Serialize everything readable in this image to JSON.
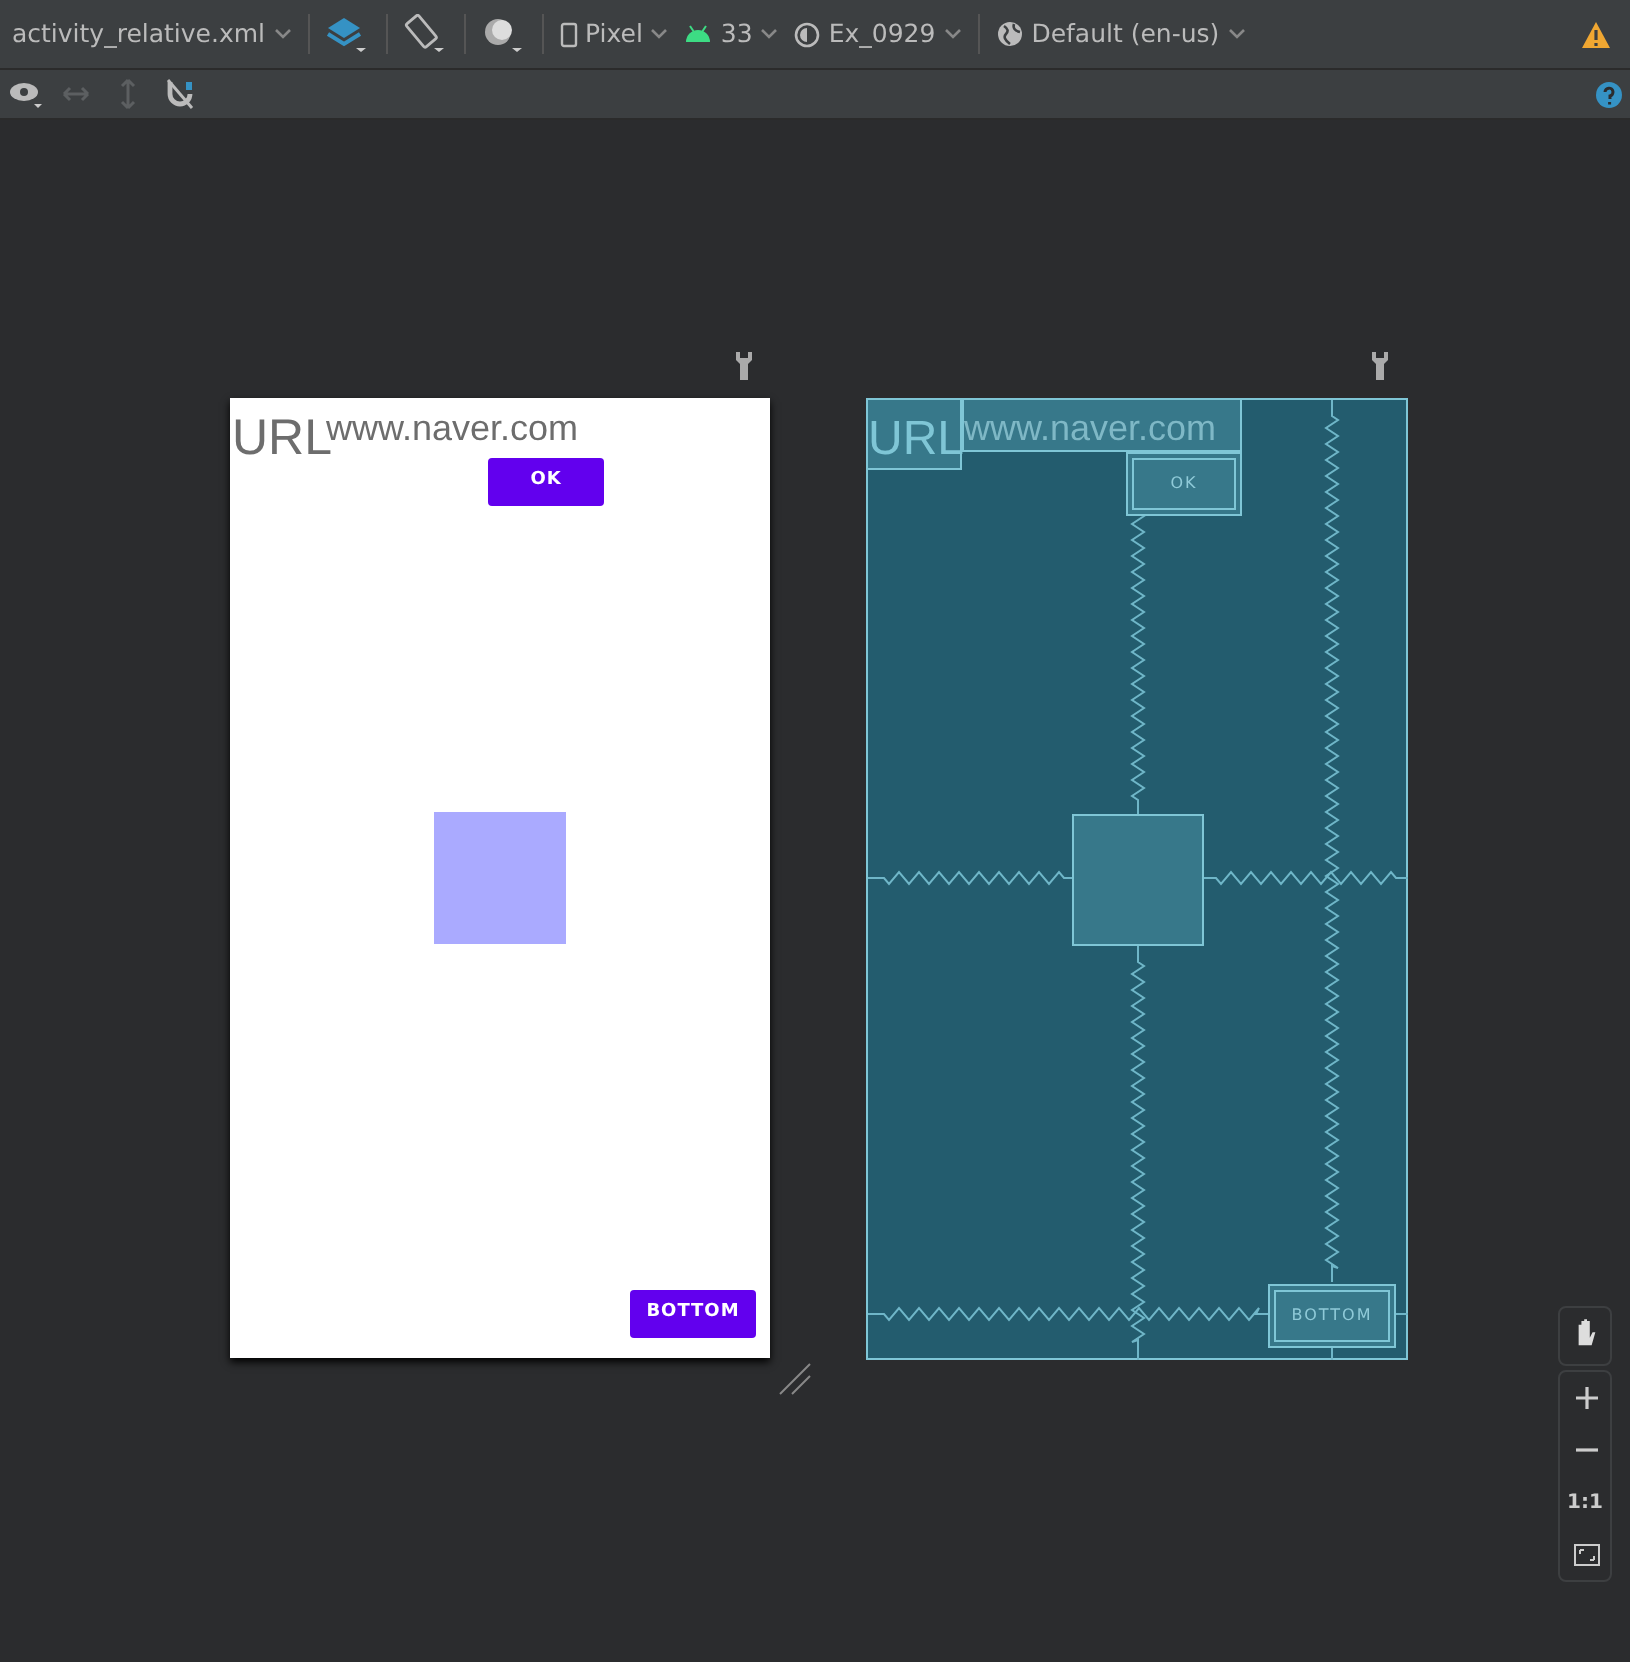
{
  "toolbar": {
    "file": "activity_relative.xml",
    "device": "Pixel",
    "api": "33",
    "theme": "Ex_0929",
    "locale": "Default (en-us)"
  },
  "view_tools": [
    {
      "kind": "eye",
      "disabled": false
    },
    {
      "kind": "horizontal",
      "disabled": true
    },
    {
      "kind": "vertical",
      "disabled": true
    },
    {
      "kind": "magnet",
      "disabled": false
    }
  ],
  "design": {
    "url_label": "URL",
    "url_value": "www.naver.com",
    "ok_button": "OK",
    "bottom_button": "BOTTOM"
  },
  "blueprint": {
    "url_label": "URL",
    "url_value": "www.naver.com",
    "ok_button": "OK",
    "bottom_button": "BOTTOM"
  },
  "zoom_controls": {
    "actual_size": "1:1"
  }
}
